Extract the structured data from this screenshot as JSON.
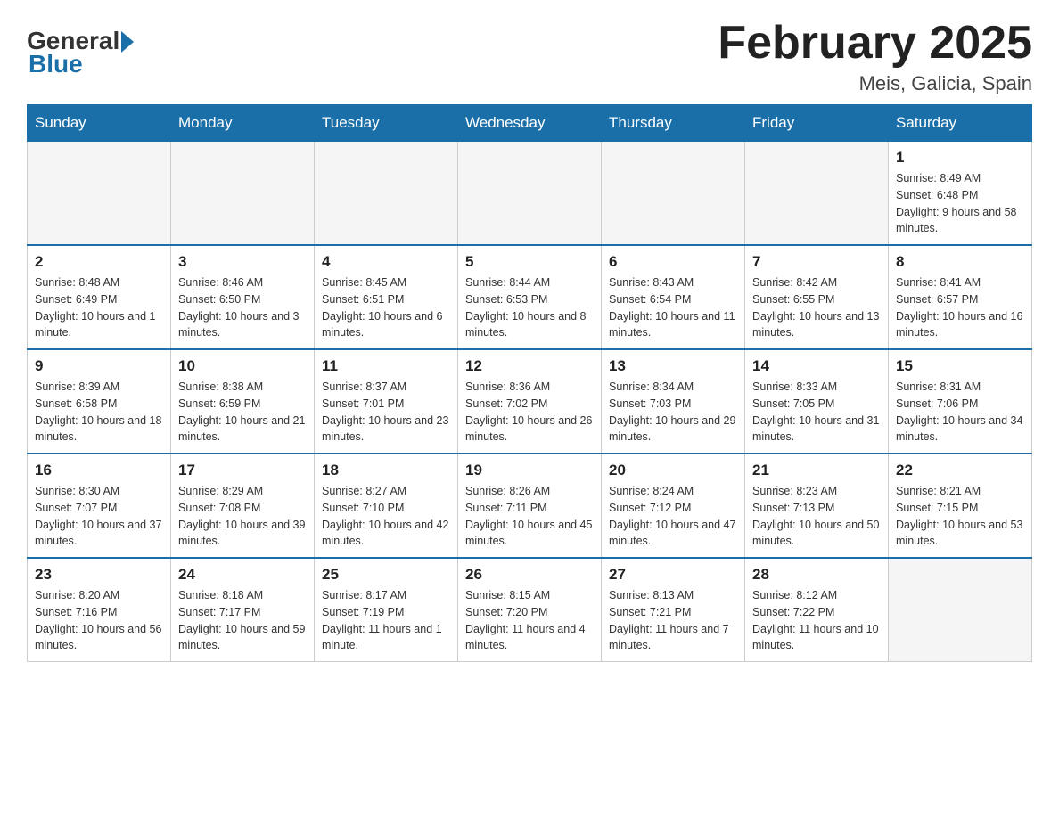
{
  "header": {
    "logo_general": "General",
    "logo_blue": "Blue",
    "title": "February 2025",
    "subtitle": "Meis, Galicia, Spain"
  },
  "days_of_week": [
    "Sunday",
    "Monday",
    "Tuesday",
    "Wednesday",
    "Thursday",
    "Friday",
    "Saturday"
  ],
  "weeks": [
    [
      {
        "day": "",
        "info": ""
      },
      {
        "day": "",
        "info": ""
      },
      {
        "day": "",
        "info": ""
      },
      {
        "day": "",
        "info": ""
      },
      {
        "day": "",
        "info": ""
      },
      {
        "day": "",
        "info": ""
      },
      {
        "day": "1",
        "info": "Sunrise: 8:49 AM\nSunset: 6:48 PM\nDaylight: 9 hours and 58 minutes."
      }
    ],
    [
      {
        "day": "2",
        "info": "Sunrise: 8:48 AM\nSunset: 6:49 PM\nDaylight: 10 hours and 1 minute."
      },
      {
        "day": "3",
        "info": "Sunrise: 8:46 AM\nSunset: 6:50 PM\nDaylight: 10 hours and 3 minutes."
      },
      {
        "day": "4",
        "info": "Sunrise: 8:45 AM\nSunset: 6:51 PM\nDaylight: 10 hours and 6 minutes."
      },
      {
        "day": "5",
        "info": "Sunrise: 8:44 AM\nSunset: 6:53 PM\nDaylight: 10 hours and 8 minutes."
      },
      {
        "day": "6",
        "info": "Sunrise: 8:43 AM\nSunset: 6:54 PM\nDaylight: 10 hours and 11 minutes."
      },
      {
        "day": "7",
        "info": "Sunrise: 8:42 AM\nSunset: 6:55 PM\nDaylight: 10 hours and 13 minutes."
      },
      {
        "day": "8",
        "info": "Sunrise: 8:41 AM\nSunset: 6:57 PM\nDaylight: 10 hours and 16 minutes."
      }
    ],
    [
      {
        "day": "9",
        "info": "Sunrise: 8:39 AM\nSunset: 6:58 PM\nDaylight: 10 hours and 18 minutes."
      },
      {
        "day": "10",
        "info": "Sunrise: 8:38 AM\nSunset: 6:59 PM\nDaylight: 10 hours and 21 minutes."
      },
      {
        "day": "11",
        "info": "Sunrise: 8:37 AM\nSunset: 7:01 PM\nDaylight: 10 hours and 23 minutes."
      },
      {
        "day": "12",
        "info": "Sunrise: 8:36 AM\nSunset: 7:02 PM\nDaylight: 10 hours and 26 minutes."
      },
      {
        "day": "13",
        "info": "Sunrise: 8:34 AM\nSunset: 7:03 PM\nDaylight: 10 hours and 29 minutes."
      },
      {
        "day": "14",
        "info": "Sunrise: 8:33 AM\nSunset: 7:05 PM\nDaylight: 10 hours and 31 minutes."
      },
      {
        "day": "15",
        "info": "Sunrise: 8:31 AM\nSunset: 7:06 PM\nDaylight: 10 hours and 34 minutes."
      }
    ],
    [
      {
        "day": "16",
        "info": "Sunrise: 8:30 AM\nSunset: 7:07 PM\nDaylight: 10 hours and 37 minutes."
      },
      {
        "day": "17",
        "info": "Sunrise: 8:29 AM\nSunset: 7:08 PM\nDaylight: 10 hours and 39 minutes."
      },
      {
        "day": "18",
        "info": "Sunrise: 8:27 AM\nSunset: 7:10 PM\nDaylight: 10 hours and 42 minutes."
      },
      {
        "day": "19",
        "info": "Sunrise: 8:26 AM\nSunset: 7:11 PM\nDaylight: 10 hours and 45 minutes."
      },
      {
        "day": "20",
        "info": "Sunrise: 8:24 AM\nSunset: 7:12 PM\nDaylight: 10 hours and 47 minutes."
      },
      {
        "day": "21",
        "info": "Sunrise: 8:23 AM\nSunset: 7:13 PM\nDaylight: 10 hours and 50 minutes."
      },
      {
        "day": "22",
        "info": "Sunrise: 8:21 AM\nSunset: 7:15 PM\nDaylight: 10 hours and 53 minutes."
      }
    ],
    [
      {
        "day": "23",
        "info": "Sunrise: 8:20 AM\nSunset: 7:16 PM\nDaylight: 10 hours and 56 minutes."
      },
      {
        "day": "24",
        "info": "Sunrise: 8:18 AM\nSunset: 7:17 PM\nDaylight: 10 hours and 59 minutes."
      },
      {
        "day": "25",
        "info": "Sunrise: 8:17 AM\nSunset: 7:19 PM\nDaylight: 11 hours and 1 minute."
      },
      {
        "day": "26",
        "info": "Sunrise: 8:15 AM\nSunset: 7:20 PM\nDaylight: 11 hours and 4 minutes."
      },
      {
        "day": "27",
        "info": "Sunrise: 8:13 AM\nSunset: 7:21 PM\nDaylight: 11 hours and 7 minutes."
      },
      {
        "day": "28",
        "info": "Sunrise: 8:12 AM\nSunset: 7:22 PM\nDaylight: 11 hours and 10 minutes."
      },
      {
        "day": "",
        "info": ""
      }
    ]
  ]
}
